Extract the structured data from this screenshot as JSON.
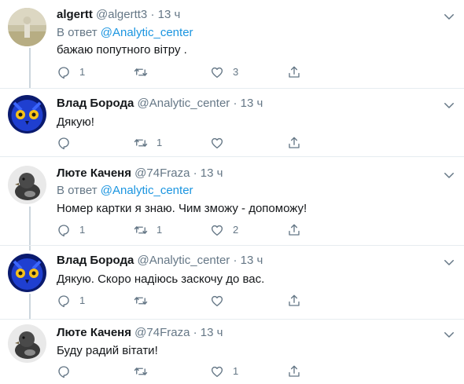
{
  "tweets": [
    {
      "name": "algertt",
      "handle": "@algertt3",
      "time": "13 ч",
      "reply_prefix": "В ответ",
      "reply_mention": "@Analytic_center",
      "text": "бажаю попутного вітру .",
      "replies": "1",
      "retweets": "",
      "likes": "3"
    },
    {
      "name": "Влад Борода",
      "handle": "@Analytic_center",
      "time": "13 ч",
      "text": "Дякую!",
      "replies": "",
      "retweets": "1",
      "likes": ""
    },
    {
      "name": "Люте Каченя",
      "handle": "@74Fraza",
      "time": "13 ч",
      "reply_prefix": "В ответ",
      "reply_mention": "@Analytic_center",
      "text": "Номер картки я знаю. Чим зможу - допоможу!",
      "replies": "1",
      "retweets": "1",
      "likes": "2"
    },
    {
      "name": "Влад Борода",
      "handle": "@Analytic_center",
      "time": "13 ч",
      "text": "Дякую. Скоро надіюсь заскочу до вас.",
      "replies": "1",
      "retweets": "",
      "likes": ""
    },
    {
      "name": "Люте Каченя",
      "handle": "@74Fraza",
      "time": "13 ч",
      "text": "Буду радий вітати!",
      "replies": "",
      "retweets": "",
      "likes": "1"
    }
  ],
  "dot": "·",
  "colors": {
    "link": "#1b95e0",
    "secondary": "#657786",
    "text": "#14171a",
    "divider": "#e6ecf0",
    "thread_line": "#ccd6dd"
  }
}
